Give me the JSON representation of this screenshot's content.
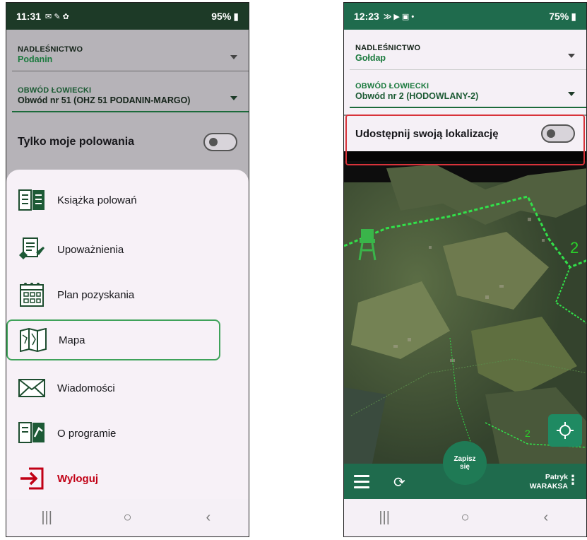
{
  "left_phone": {
    "status": {
      "time": "11:31",
      "right": "95%"
    },
    "nadlesnictwo": {
      "label": "NADLEŚNICTWO",
      "value": "Podanin"
    },
    "obwod": {
      "label": "OBWÓD ŁOWIECKI",
      "value": "Obwód nr 51 (OHZ 51 PODANIN-MARGO)"
    },
    "toggle_label": "Tylko moje polowania",
    "menu": [
      {
        "label": "Książka polowań",
        "icon": "book-icon"
      },
      {
        "label": "Upoważnienia",
        "icon": "authorization-icon"
      },
      {
        "label": "Plan pozyskania",
        "icon": "calendar-plan-icon"
      },
      {
        "label": "Mapa",
        "icon": "map-icon"
      },
      {
        "label": "Wiadomości",
        "icon": "envelope-icon"
      },
      {
        "label": "O programie",
        "icon": "about-icon"
      },
      {
        "label": "Wyloguj",
        "icon": "logout-icon"
      }
    ],
    "navbar": {
      "recent": "|||",
      "home": "○",
      "back": "‹"
    }
  },
  "right_phone": {
    "status": {
      "time": "12:23",
      "right": "75%"
    },
    "nadlesnictwo": {
      "label": "NADLEŚNICTWO",
      "value": "Gołdap"
    },
    "obwod": {
      "label": "OBWÓD ŁOWIECKI",
      "value": "Obwód nr 2 (HODOWLANY-2)"
    },
    "toggle_label": "Udostępnij swoją lokalizację",
    "map_labels": {
      "area_number": "2"
    },
    "bottom_bar": {
      "fab_line1": "Zapisz",
      "fab_line2": "się",
      "user_first": "Patryk",
      "user_last": "WARAKSA"
    },
    "navbar": {
      "recent": "|||",
      "home": "○",
      "back": "‹"
    }
  },
  "colors": {
    "brand_green": "#1f6b4d",
    "accent_green": "#3fa25a",
    "logout_red": "#c10015",
    "highlight_red": "#d8333a"
  }
}
